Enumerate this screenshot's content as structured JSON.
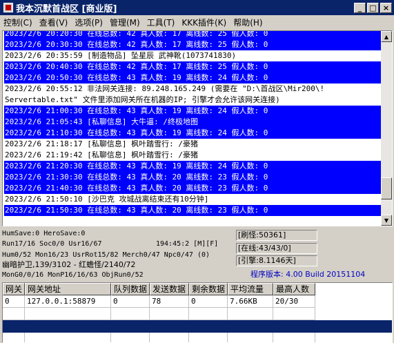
{
  "window": {
    "title": "我本沉默首战区 [商业版]",
    "buttons": {
      "minimize": "_",
      "maximize": "□",
      "close": "×"
    }
  },
  "menu": [
    "控制(C)",
    "查看(V)",
    "选项(P)",
    "管理(M)",
    "工具(T)",
    "KKK插件(K)",
    "帮助(H)"
  ],
  "log": [
    {
      "text": "2023/2/6 20:20:30 在线总数: 42 真人数: 17 离线数: 25 假人数: 0",
      "hl": true
    },
    {
      "text": "2023/2/6 20:30:30 在线总数: 42 真人数: 17 离线数: 25 假人数: 0",
      "hl": true
    },
    {
      "text": "2023/2/6 20:35:59 [制造物品] 坠星辰 武神靴(1073741830)",
      "hl": false
    },
    {
      "text": "2023/2/6 20:40:30 在线总数: 42 真人数: 17 离线数: 25 假人数: 0",
      "hl": true
    },
    {
      "text": "2023/2/6 20:50:30 在线总数: 43 真人数: 19 离线数: 24 假人数: 0",
      "hl": true
    },
    {
      "text": "2023/2/6 20:55:12 非法网关连接: 89.248.165.249 (需要在 \"D:\\首战区\\Mir200\\!",
      "hl": false
    },
    {
      "text": "Servertable.txt\" 文件里添加网关所在机器的IP; 引擎才会允许该网关连接)",
      "hl": false
    },
    {
      "text": "2023/2/6 21:00:30 在线总数: 43 真人数: 19 离线数: 24 假人数: 0",
      "hl": true
    },
    {
      "text": "2023/2/6 21:05:43 [私聊信息] 大牛逼: /终极地图",
      "hl": true
    },
    {
      "text": "2023/2/6 21:10:30 在线总数: 43 真人数: 19 离线数: 24 假人数: 0",
      "hl": true
    },
    {
      "text": "2023/2/6 21:18:17 [私聊信息] 枫叶踏雪行: /豪猪",
      "hl": false
    },
    {
      "text": "2023/2/6 21:19:42 [私聊信息] 枫叶踏雪行: /豪猪",
      "hl": false
    },
    {
      "text": "2023/2/6 21:20:30 在线总数: 43 真人数: 19 离线数: 24 假人数: 0",
      "hl": true
    },
    {
      "text": "2023/2/6 21:30:30 在线总数: 43 真人数: 20 离线数: 23 假人数: 0",
      "hl": true
    },
    {
      "text": "2023/2/6 21:40:30 在线总数: 43 真人数: 20 离线数: 23 假人数: 0",
      "hl": true
    },
    {
      "text": "2023/2/6 21:50:10 [沙巴克 攻城战离结束还有10分钟]",
      "hl": false
    },
    {
      "text": "2023/2/6 21:50:30 在线总数: 43 真人数: 20 离线数: 23 假人数: 0",
      "hl": true
    }
  ],
  "scrollbar": {
    "position_fraction": 0.9
  },
  "status": {
    "line1": "HumSave:0 HeroSave:0",
    "line2": "Run17/16 Soc0/0 Usr16/67",
    "time": "194:45:2 [M][F]",
    "line3": "Hum0/52 Mon16/23 UsrRot15/82 Merch0/47 Npc0/47 (0)",
    "line4": "幽暗护卫,139/3102 - 红蟾怪/2140/72",
    "line5": "MonG0/0/16 MonP16/16/63 ObjRun0/52",
    "box1": "[刷怪:50361]",
    "box2": "[在线:43/43/0]",
    "box3": "[引擎:8.1146天]",
    "version": "程序版本: 4.00 Build 20151104"
  },
  "table": {
    "headers": [
      "网关",
      "网关地址",
      "队列数据",
      "发送数据",
      "剩余数据",
      "平均流量",
      "最高人数"
    ],
    "rows": [
      [
        "0",
        "127.0.0.1:58879",
        "0",
        "78",
        "0",
        "7.66KB",
        "20/30"
      ]
    ]
  }
}
